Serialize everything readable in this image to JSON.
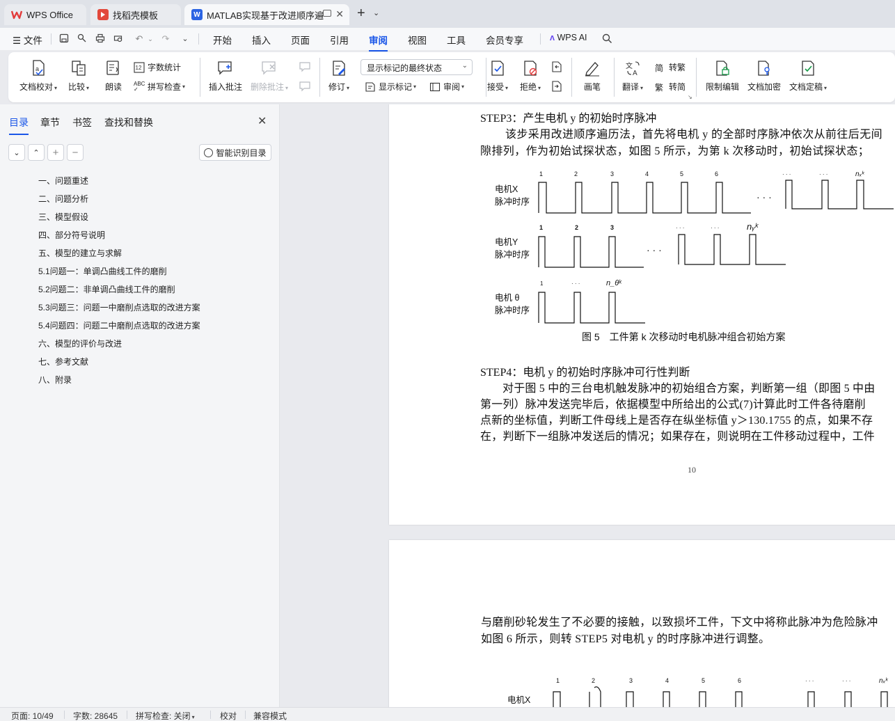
{
  "tabs": [
    {
      "label": "WPS Office"
    },
    {
      "label": "找稻壳模板"
    },
    {
      "label": "MATLAB实现基于改进顺序遍历"
    }
  ],
  "menu": {
    "file": "文件",
    "items": [
      "开始",
      "插入",
      "页面",
      "引用",
      "审阅",
      "视图",
      "工具",
      "会员专享"
    ],
    "active": "审阅",
    "ai": "WPS AI"
  },
  "ribbon": {
    "proofread": "文档校对",
    "compare": "比较",
    "read_aloud": "朗读",
    "word_count": "字数统计",
    "spell_check": "拼写检查",
    "insert_comment": "插入批注",
    "delete_comment": "删除批注",
    "revise": "修订",
    "display_mode": "显示标记的最终状态",
    "show_markup": "显示标记",
    "review": "审阅",
    "accept": "接受",
    "reject": "拒绝",
    "pen": "画笔",
    "translate": "翻译",
    "to_traditional": "转繁",
    "to_simplified": "转简",
    "restrict_edit": "限制编辑",
    "encrypt": "文档加密",
    "finalize": "文档定稿"
  },
  "nav": {
    "tabs": [
      "目录",
      "章节",
      "书签",
      "查找和替换"
    ],
    "smart_toc": "智能识别目录",
    "toc": [
      "一、问题重述",
      "二、问题分析",
      "三、模型假设",
      "四、部分符号说明",
      "五、模型的建立与求解",
      "5.1问题一：单调凸曲线工件的磨削",
      "5.2问题二：非单调凸曲线工件的磨削",
      "5.3问题三：问题一中磨削点选取的改进方案",
      "5.4问题四：问题二中磨削点选取的改进方案",
      "六、模型的评价与改进",
      "七、参考文献",
      "八、附录"
    ]
  },
  "doc": {
    "step3_title": "STEP3：产生电机 y 的初始时序脉冲",
    "p1_line1": "该步采用改进顺序遍历法，首先将电机 y 的全部时序脉冲依次从前往后无间",
    "p1_line2": "隙排列，作为初始试探状态，如图 5 所示，为第 k 次移动时，初始试探状态；",
    "fig_labels": {
      "motor_x": "电机X",
      "motor_y": "电机Y",
      "motor_theta": "电机 θ",
      "pulse_seq": "脉冲时序",
      "dots": "· · ·",
      "x_ticks": [
        "1",
        "2",
        "3",
        "4",
        "5",
        "6",
        "· · ·",
        "· · ·",
        "nₓᵏ"
      ],
      "y_ticks": [
        "1",
        "2",
        "3",
        "· · ·",
        "· · ·",
        "nᵧᵏ"
      ],
      "theta_ticks": [
        "1",
        "· · ·",
        "n_θᵏ"
      ]
    },
    "fig5_caption": "图 5　工件第 k 次移动时电机脉冲组合初始方案",
    "step4_title": "STEP4：电机 y 的初始时序脉冲可行性判断",
    "p2_line1": "对于图 5 中的三台电机触发脉冲的初始组合方案，判断第一组（即图 5 中由",
    "p2_line2": "第一列）脉冲发送完毕后，依据模型中所给出的公式(7)计算此时工件各待磨削",
    "p2_line3": "点新的坐标值，判断工件母线上是否存在纵坐标值 y＞130.1755 的点，如果不存",
    "p2_line4": "在，判断下一组脉冲发送后的情况；如果存在，则说明在工件移动过程中，工件",
    "page_number": "10",
    "p3_line1": "与磨削砂轮发生了不必要的接触，以致损坏工件，下文中将称此脉冲为危险脉冲",
    "p3_line2": "如图 6 所示，则转 STEP5 对电机 y 的时序脉冲进行调整。",
    "fig6_ticks": [
      "1",
      "2",
      "3",
      "4",
      "5",
      "6",
      "· · ·",
      "· · ·",
      "nₓᵏ"
    ]
  },
  "status": {
    "page": "页面: 10/49",
    "words": "字数: 28645",
    "spell": "拼写检查: 关闭",
    "proof": "校对",
    "compat": "兼容模式"
  },
  "colors": {
    "accent": "#1a56e8",
    "wps_red": "#e23b3b",
    "docer_red": "#e2483b",
    "word_blue": "#2b64e3"
  }
}
